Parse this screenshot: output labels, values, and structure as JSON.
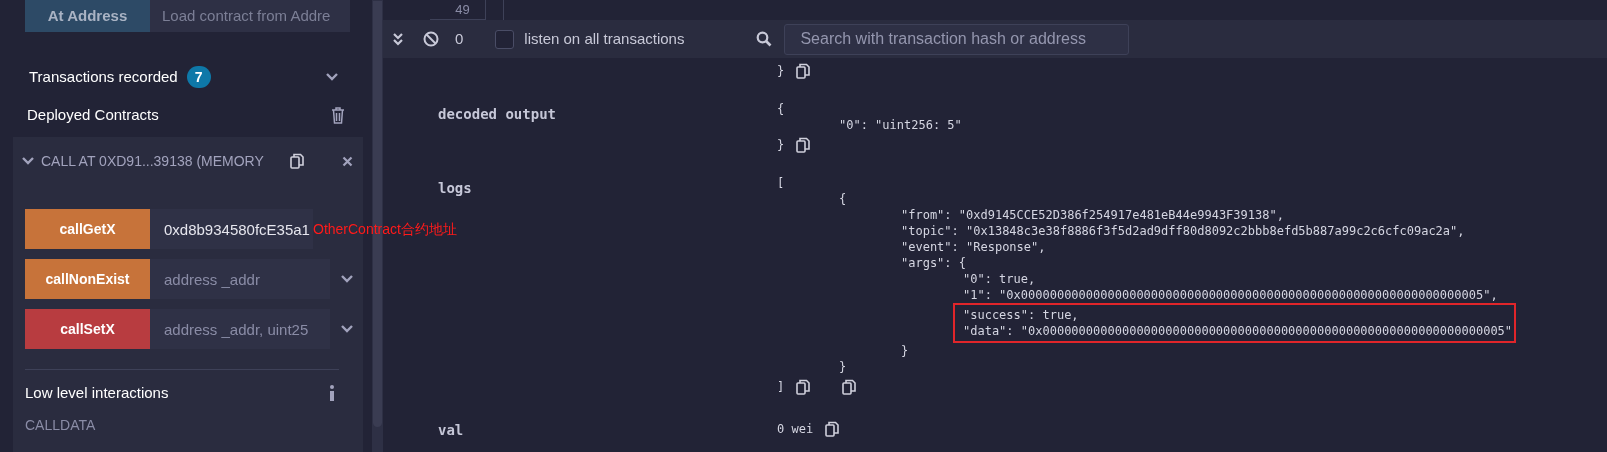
{
  "left_panel": {
    "at_address_button": "At Address",
    "address_placeholder": "Load contract from Addre",
    "transactions": {
      "label": "Transactions recorded",
      "count": "7",
      "expanded": false
    },
    "deployed_title": "Deployed Contracts",
    "contract": {
      "title": "CALL AT 0XD91...39138 (MEMORY",
      "expanded": true,
      "functions": [
        {
          "name": "callGetX",
          "kind": "call",
          "value": "0xd8b934580fcE35a1",
          "annotation": "OtherContract合约地址"
        },
        {
          "name": "callNonExist",
          "kind": "call",
          "placeholder": "address _addr"
        },
        {
          "name": "callSetX",
          "kind": "transact",
          "placeholder": "address _addr, uint25"
        }
      ],
      "low_level_title": "Low level interactions",
      "calldata_label": "CALLDATA"
    }
  },
  "editor": {
    "line_number": "49"
  },
  "terminal": {
    "pending_count": "0",
    "listen_all": {
      "label": "listen on all transactions",
      "checked": false
    },
    "search_placeholder": "Search with transaction hash or address"
  },
  "output_rows": [
    {
      "label": "",
      "lines": [
        {
          "text": "}",
          "kind": "copy"
        }
      ]
    },
    {
      "label": "decoded output",
      "lines": [
        {
          "text": "{",
          "kind": "plain"
        },
        {
          "text": "\t\"0\": \"uint256: 5\"",
          "kind": "plain"
        },
        {
          "text": "}",
          "kind": "copy"
        }
      ]
    },
    {
      "label": "logs",
      "lines": [
        {
          "text": "[",
          "kind": "plain"
        },
        {
          "text": "\t{",
          "kind": "plain"
        },
        {
          "text": "\t\t\"from\": \"0xd9145CCE52D386f254917e481eB44e9943F39138\",",
          "kind": "plain"
        },
        {
          "text": "\t\t\"topic\": \"0x13848c3e38f8886f3f5d2ad9dff80d8092c2bbb8efd5b887a99c2c6cfc09ac2a\",",
          "kind": "plain"
        },
        {
          "text": "\t\t\"event\": \"Response\",",
          "kind": "plain"
        },
        {
          "text": "\t\t\"args\": {",
          "kind": "plain"
        },
        {
          "text": "\t\t\t\"0\": true,",
          "kind": "plain"
        },
        {
          "text": "\t\t\t\"1\": \"0x0000000000000000000000000000000000000000000000000000000000000005\",",
          "kind": "plain"
        },
        {
          "text": "\"success\": true,",
          "kind": "highlight"
        },
        {
          "text": "\"data\": \"0x0000000000000000000000000000000000000000000000000000000000000005\"",
          "kind": "highlight"
        },
        {
          "text": "\t\t}",
          "kind": "plain"
        },
        {
          "text": "\t}",
          "kind": "plain"
        },
        {
          "text": "]",
          "kind": "copy2"
        }
      ]
    },
    {
      "label": "val",
      "lines": [
        {
          "text": "0 wei",
          "kind": "copy"
        }
      ]
    }
  ]
}
